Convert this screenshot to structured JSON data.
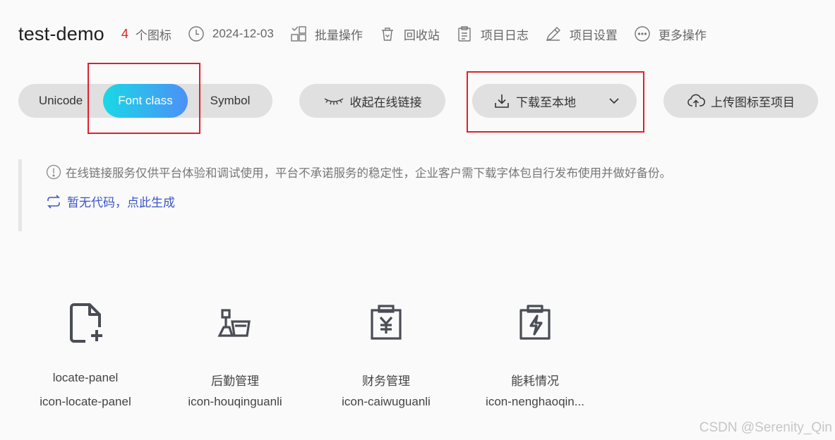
{
  "header": {
    "title": "test-demo",
    "icon_count": "4",
    "icon_count_label": "个图标",
    "date": "2024-12-03",
    "batch_ops": "批量操作",
    "recycle_bin": "回收站",
    "project_log": "项目日志",
    "project_settings": "项目设置",
    "more_ops": "更多操作"
  },
  "toolbar": {
    "tabs": [
      {
        "label": "Unicode",
        "selected": false
      },
      {
        "label": "Font class",
        "selected": true
      },
      {
        "label": "Symbol",
        "selected": false
      }
    ],
    "collapse_link": "收起在线链接",
    "download_local": "下载至本地",
    "upload_to_project": "上传图标至项目"
  },
  "notice": {
    "text": "在线链接服务仅供平台体验和调试使用，平台不承诺服务的稳定性，企业客户需下载字体包自行发布使用并做好备份。",
    "generate_link": "暂无代码，点此生成"
  },
  "icons": [
    {
      "name": "locate-panel",
      "code": "icon-locate-panel",
      "icon": "file-add-icon"
    },
    {
      "name": "后勤管理",
      "code": "icon-houqinguanli",
      "icon": "logistics-icon"
    },
    {
      "name": "财务管理",
      "code": "icon-caiwuguanli",
      "icon": "finance-icon"
    },
    {
      "name": "能耗情况",
      "code": "icon-nenghaoqin...",
      "icon": "energy-icon"
    }
  ],
  "colors": {
    "accent_gradient_start": "#1ad8e6",
    "accent_gradient_end": "#4c90f7",
    "count_red": "#e02020",
    "link_blue": "#3c55c9",
    "highlight_red": "#e0202a"
  },
  "watermark": "CSDN @Serenity_Qin"
}
